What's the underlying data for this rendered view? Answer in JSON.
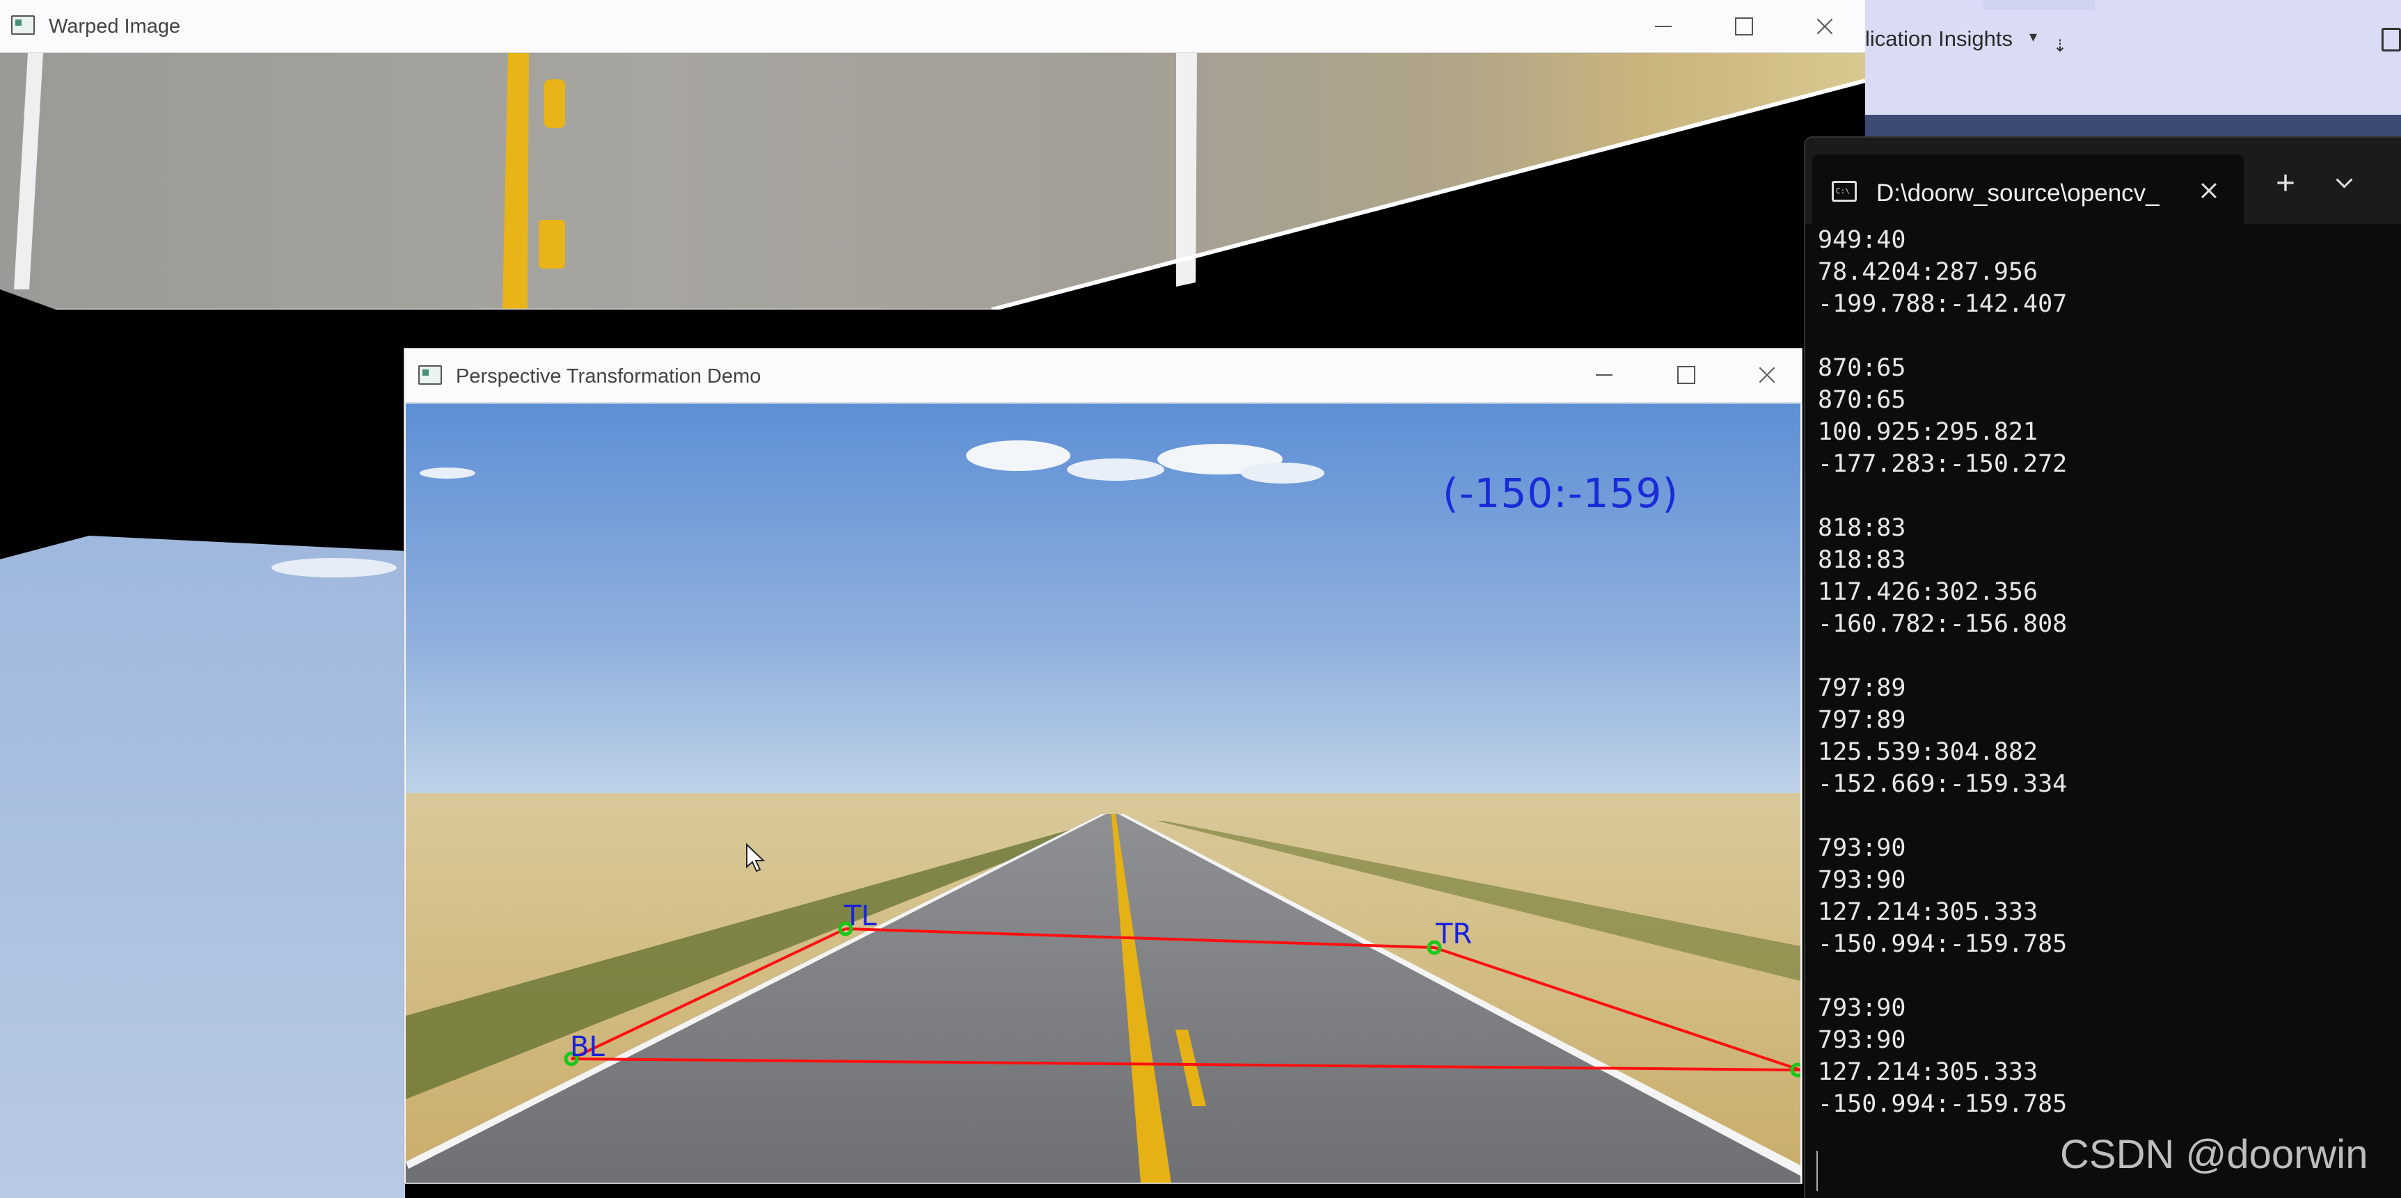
{
  "ide_background": {
    "menu_label": "lication Insights"
  },
  "warped_window": {
    "title": "Warped Image"
  },
  "demo_window": {
    "title": "Perspective Transformation Demo",
    "coordinate_readout": "(-150:-159)",
    "points": {
      "tl_label": "TL",
      "tr_label": "TR",
      "bl_label": "BL"
    }
  },
  "terminal": {
    "tab_title": "D:\\doorw_source\\opencv_",
    "new_tab_label": "+",
    "output": "949:40\n78.4204:287.956\n-199.788:-142.407\n\n870:65\n870:65\n100.925:295.821\n-177.283:-150.272\n\n818:83\n818:83\n117.426:302.356\n-160.782:-156.808\n\n797:89\n797:89\n125.539:304.882\n-152.669:-159.334\n\n793:90\n793:90\n127.214:305.333\n-150.994:-159.785\n\n793:90\n793:90\n127.214:305.333\n-150.994:-159.785"
  },
  "watermark": "CSDN @doorwin",
  "colors": {
    "window_titlebar": "#fbfbfd",
    "terminal_bg": "#0c0c0c",
    "terminal_text": "#e8e8e8",
    "readout_blue": "#1a2bd8",
    "quad_red": "#ff1010",
    "point_green": "#18c818",
    "ide_accent": "#3d4a74"
  },
  "icons": {
    "window_app": "window-app-icon",
    "minimize": "minimize-icon",
    "maximize": "maximize-icon",
    "close": "close-icon",
    "terminal_tab": "terminal-icon",
    "tab_close": "tab-close-icon",
    "dropdown": "chevron-down-icon",
    "mouse_cursor": "mouse-pointer-icon"
  }
}
